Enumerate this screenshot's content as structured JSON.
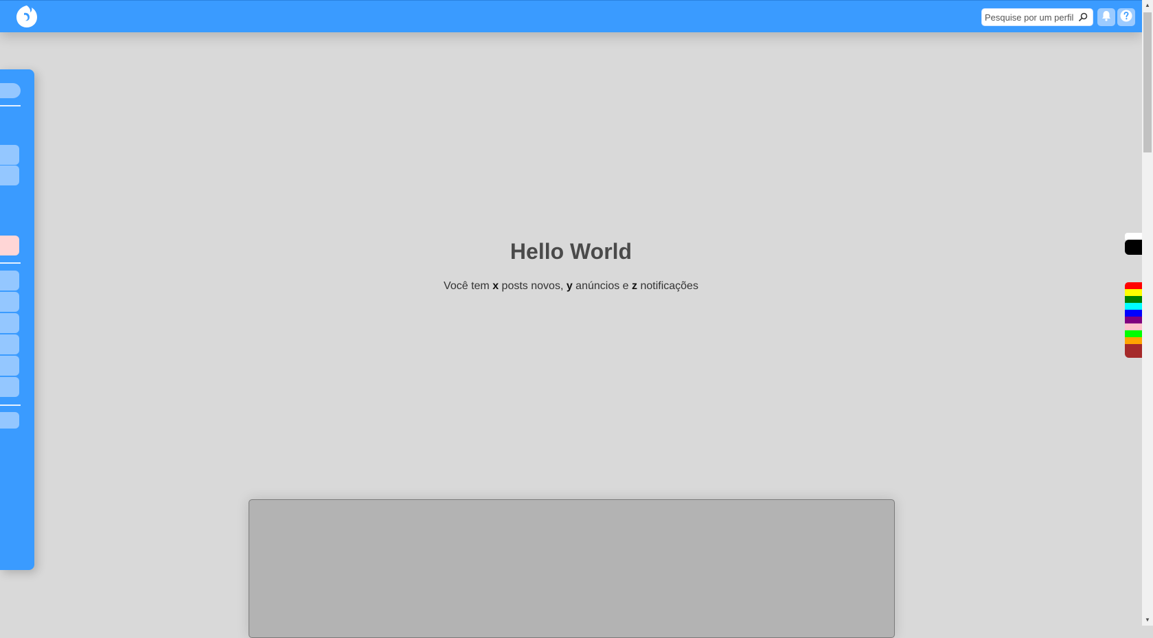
{
  "header": {
    "logo": "app-logo",
    "search": {
      "placeholder": "Pesquise por um perfil",
      "icon": "search-icon"
    },
    "buttons": [
      {
        "name": "notifications-button",
        "icon": "bell-icon"
      },
      {
        "name": "help-button",
        "icon": "help-icon"
      }
    ]
  },
  "hero": {
    "title": "Hello World",
    "sub_prefix": "Você tem ",
    "posts_var": "x",
    "posts_text": " posts novos, ",
    "ads_var": "y",
    "ads_text": " anúncios e ",
    "notif_var": "z",
    "notif_text": " notificações"
  },
  "colors": {
    "brand": "#3a9bff",
    "sidebar_item": "#94c7ff",
    "sidebar_item_alert": "#ffd6d6",
    "page_bg": "#d9d9d9",
    "panel_bg": "#b3b3b3"
  },
  "theme_swatches": [
    "#ffffff",
    "#000000",
    "#ff0000",
    "#ffff00",
    "#008000",
    "#00ffff",
    "#0000ff",
    "#800080",
    "#ffc0cb",
    "#00ff00",
    "#ffa500",
    "#a52a2a"
  ]
}
